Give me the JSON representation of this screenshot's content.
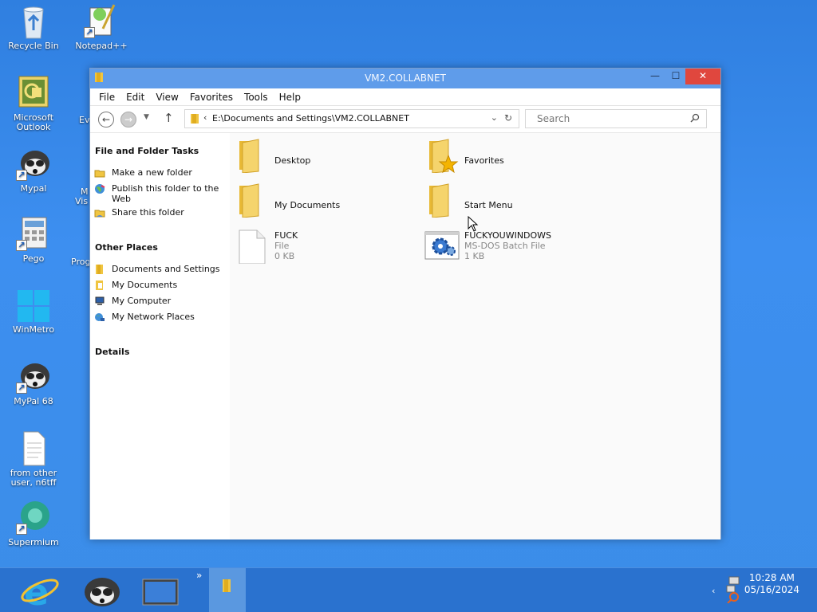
{
  "desktop": {
    "icons": [
      {
        "label": "Recycle Bin",
        "icon": "recycle-bin-icon"
      },
      {
        "label": "Notepad++",
        "icon": "notepad-plus-plus-icon"
      },
      {
        "label": "Microsoft Outlook",
        "icon": "outlook-icon"
      },
      {
        "label": "Mypal",
        "icon": "mypal-icon"
      },
      {
        "label": "Pego",
        "icon": "pego-icon"
      },
      {
        "label": "WinMetro",
        "icon": "winmetro-icon"
      },
      {
        "label": "MyPal 68",
        "icon": "mypal68-icon"
      },
      {
        "label": "from other user, n6tff",
        "icon": "document-icon"
      },
      {
        "label": "Supermium",
        "icon": "supermium-icon"
      }
    ],
    "partial_labels": [
      "Ev",
      "M",
      "Vis",
      "Prog"
    ]
  },
  "window": {
    "title": "VM2.COLLABNET",
    "menu": [
      "File",
      "Edit",
      "View",
      "Favorites",
      "Tools",
      "Help"
    ],
    "address_path": "E:\\Documents and Settings\\VM2.COLLABNET",
    "search_placeholder": "Search",
    "left_pane": {
      "file_tasks_title": "File and Folder Tasks",
      "file_tasks": [
        "Make a new folder",
        "Publish this folder to the Web",
        "Share this folder"
      ],
      "other_places_title": "Other Places",
      "other_places": [
        "Documents and Settings",
        "My Documents",
        "My Computer",
        "My Network Places"
      ],
      "details_title": "Details"
    },
    "items": [
      {
        "name": "Desktop",
        "type": "folder"
      },
      {
        "name": "Favorites",
        "type": "favorites-folder"
      },
      {
        "name": "My Documents",
        "type": "folder"
      },
      {
        "name": "Start Menu",
        "type": "folder"
      },
      {
        "name": "FUCK",
        "kind": "File",
        "size": "0 KB",
        "type": "file"
      },
      {
        "name": "FUCKYOUWINDOWS",
        "kind": "MS-DOS Batch File",
        "size": "1 KB",
        "type": "batch"
      }
    ]
  },
  "taskbar": {
    "time": "10:28 AM",
    "date": "05/16/2024"
  },
  "colors": {
    "desktop": "#3b8de8",
    "taskbar": "#2a72cf",
    "titlebar": "#5f9cea",
    "close": "#e0473e"
  }
}
